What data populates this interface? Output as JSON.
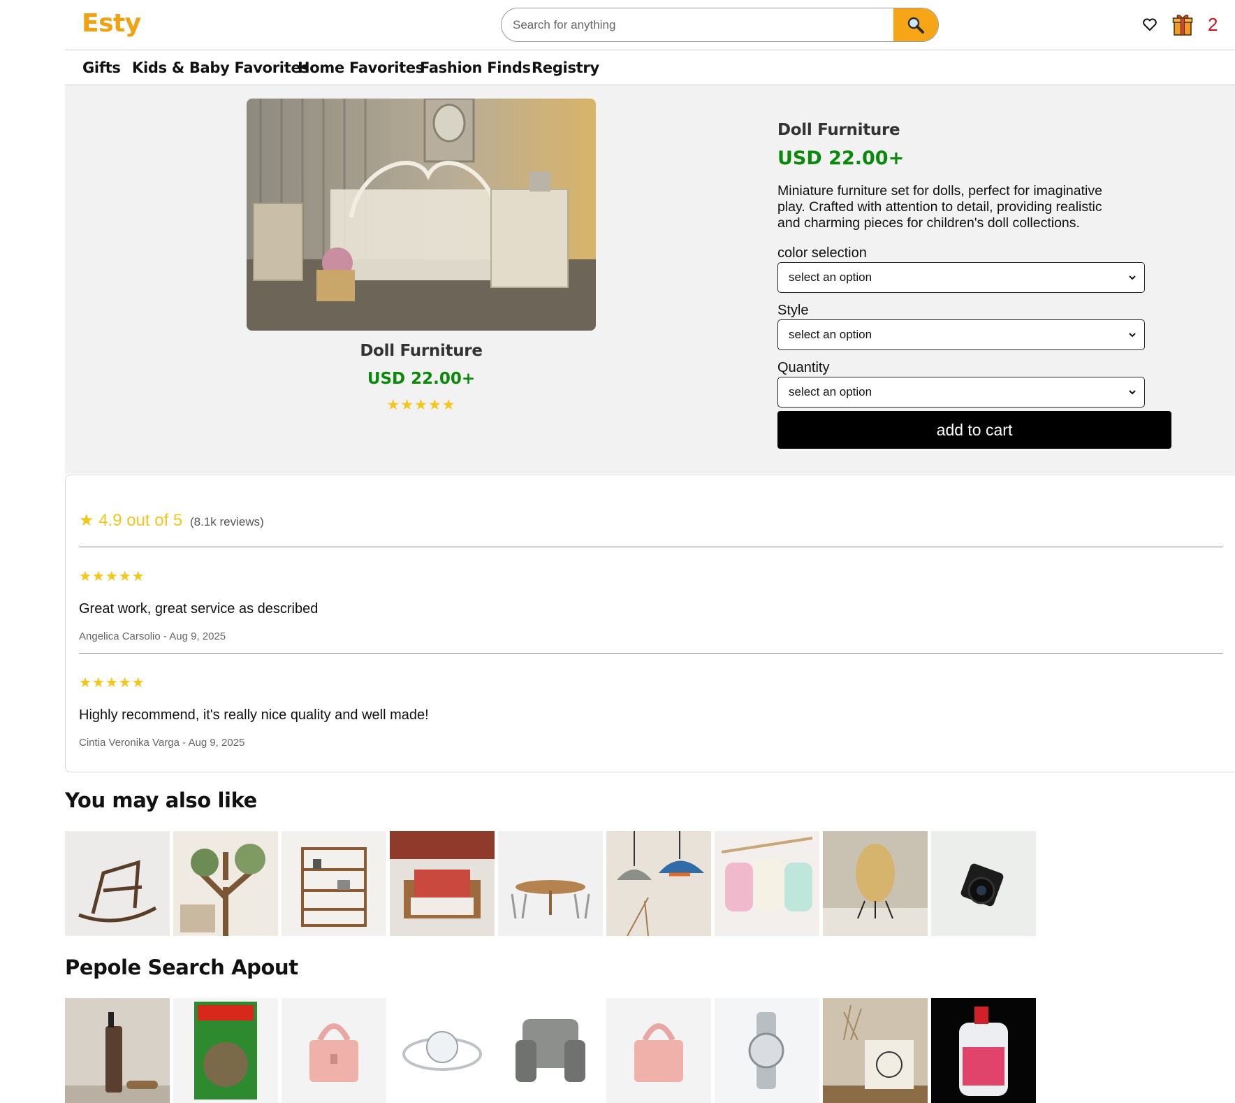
{
  "header": {
    "logo": "Esty",
    "search_placeholder": "Search for anything",
    "cart_count": "2"
  },
  "nav": {
    "items": [
      "Gifts",
      "Kids & Baby Favorites",
      "Home Favorites",
      "Fashion Finds",
      "Registry"
    ]
  },
  "product": {
    "card_title": "Doll Furniture",
    "card_price": "USD 22.00+",
    "card_stars": "★★★★★",
    "title": "Doll Furniture",
    "price": "USD 22.00+",
    "description": "Miniature furniture set for dolls, perfect for imaginative play. Crafted with attention to detail, providing realistic and charming pieces for children's doll collections.",
    "color_label": "color selection",
    "color_value": "select an option",
    "style_label": "Style",
    "style_value": "select an option",
    "quantity_label": "Quantity",
    "quantity_value": "select an option",
    "add_to_cart": "add to cart"
  },
  "reviews": {
    "summary_star": "★",
    "summary_score": "4.9 out of 5",
    "summary_count": "(8.1k reviews)",
    "items": [
      {
        "stars": "★★★★★",
        "text": "Great work, great service as described",
        "meta": "Angelica Carsolio - Aug 9, 2025"
      },
      {
        "stars": "★★★★★",
        "text": "Highly recommend, it's really nice quality and well made!",
        "meta": "Cintia Veronika Varga - Aug 9, 2025"
      }
    ]
  },
  "also_like": {
    "title": "You may also like",
    "items": [
      "rocking-chair",
      "tree-shelf",
      "bookshelf",
      "armchair",
      "dining-table",
      "pendant-lamps",
      "backpacks",
      "table-lamp",
      "camera"
    ]
  },
  "people_search": {
    "title": "Pepole Search Apout",
    "items": [
      "lotion-bottle",
      "pepper-powder",
      "pink-bag",
      "diamond-ring",
      "gray-armchair",
      "pink-bag-2",
      "wrist-watch",
      "tote-bag",
      "detergent"
    ]
  },
  "colors": {
    "logo": "#f2a111",
    "search_button": "#f5a516",
    "price": "#0a8a0a",
    "stars": "#f5c518",
    "cart_count": "#d0101a"
  }
}
